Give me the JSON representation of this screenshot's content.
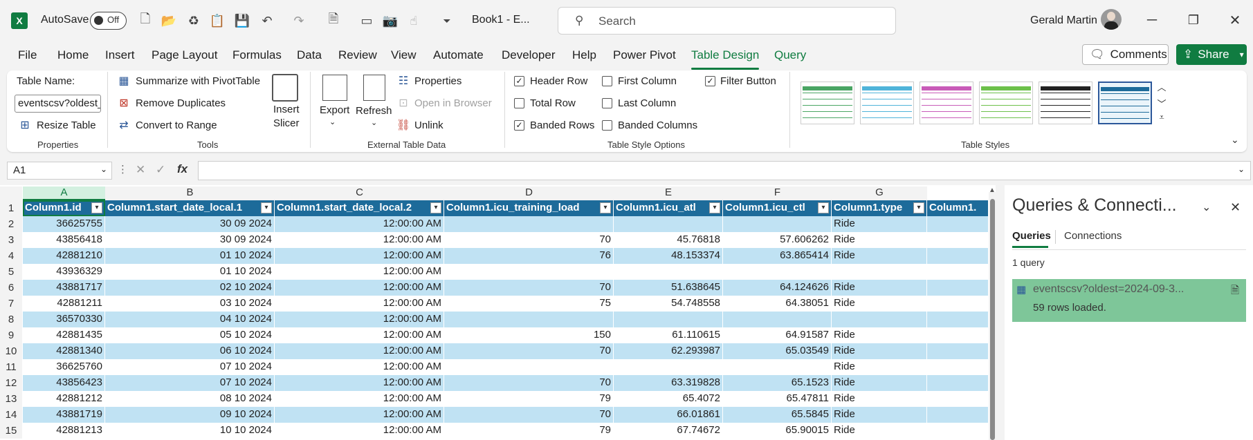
{
  "titlebar": {
    "autosave_label": "AutoSave",
    "autosave_state": "Off",
    "doc_title": "Book1  -  E...",
    "search_placeholder": "Search",
    "user_name": "Gerald Martin"
  },
  "menu": [
    "File",
    "Home",
    "Insert",
    "Page Layout",
    "Formulas",
    "Data",
    "Review",
    "View",
    "Automate",
    "Developer",
    "Help",
    "Power Pivot",
    "Table Design",
    "Query"
  ],
  "menu_active": "Table Design",
  "actions": {
    "comments": "Comments",
    "share": "Share"
  },
  "ribbon": {
    "properties": {
      "table_name_label": "Table Name:",
      "table_name_value": "eventscsv?oldest_",
      "resize": "Resize Table",
      "group": "Properties"
    },
    "tools": {
      "summarize": "Summarize with PivotTable",
      "remove_dup": "Remove Duplicates",
      "convert": "Convert to Range",
      "insert_slicer_1": "Insert",
      "insert_slicer_2": "Slicer",
      "group": "Tools"
    },
    "external": {
      "export": "Export",
      "refresh": "Refresh",
      "properties": "Properties",
      "open_browser": "Open in Browser",
      "unlink": "Unlink",
      "group": "External Table Data"
    },
    "style_options": {
      "header_row": "Header Row",
      "total_row": "Total Row",
      "banded_rows": "Banded Rows",
      "first_column": "First Column",
      "last_column": "Last Column",
      "banded_columns": "Banded Columns",
      "filter_button": "Filter Button",
      "group": "Table Style Options",
      "checked": {
        "header_row": true,
        "total_row": false,
        "banded_rows": true,
        "first_column": false,
        "last_column": false,
        "banded_columns": false,
        "filter_button": true
      }
    },
    "styles": {
      "group": "Table Styles",
      "colors": [
        "#4aa564",
        "#4fb3d9",
        "#c85bb8",
        "#6cc04a",
        "#222222",
        "#1d6b9a"
      ]
    }
  },
  "formula_bar": {
    "name_box": "A1",
    "fx": "fx",
    "formula": ""
  },
  "columns": [
    "A",
    "B",
    "C",
    "D",
    "E",
    "F",
    "G"
  ],
  "table": {
    "headers": [
      "Column1.id",
      "Column1.start_date_local.1",
      "Column1.start_date_local.2",
      "Column1.icu_training_load",
      "Column1.icu_atl",
      "Column1.icu_ctl",
      "Column1.type",
      "Column1."
    ],
    "rows": [
      [
        "36625755",
        "30 09 2024",
        "12:00:00 AM",
        "",
        "",
        "",
        "Ride",
        ""
      ],
      [
        "43856418",
        "30 09 2024",
        "12:00:00 AM",
        "70",
        "45.76818",
        "57.606262",
        "Ride",
        ""
      ],
      [
        "42881210",
        "01 10 2024",
        "12:00:00 AM",
        "76",
        "48.153374",
        "63.865414",
        "Ride",
        ""
      ],
      [
        "43936329",
        "01 10 2024",
        "12:00:00 AM",
        "",
        "",
        "",
        "",
        ""
      ],
      [
        "43881717",
        "02 10 2024",
        "12:00:00 AM",
        "70",
        "51.638645",
        "64.124626",
        "Ride",
        ""
      ],
      [
        "42881211",
        "03 10 2024",
        "12:00:00 AM",
        "75",
        "54.748558",
        "64.38051",
        "Ride",
        ""
      ],
      [
        "36570330",
        "04 10 2024",
        "12:00:00 AM",
        "",
        "",
        "",
        "",
        ""
      ],
      [
        "42881435",
        "05 10 2024",
        "12:00:00 AM",
        "150",
        "61.110615",
        "64.91587",
        "Ride",
        ""
      ],
      [
        "42881340",
        "06 10 2024",
        "12:00:00 AM",
        "70",
        "62.293987",
        "65.03549",
        "Ride",
        ""
      ],
      [
        "36625760",
        "07 10 2024",
        "12:00:00 AM",
        "",
        "",
        "",
        "Ride",
        ""
      ],
      [
        "43856423",
        "07 10 2024",
        "12:00:00 AM",
        "70",
        "63.319828",
        "65.1523",
        "Ride",
        ""
      ],
      [
        "42881212",
        "08 10 2024",
        "12:00:00 AM",
        "79",
        "65.4072",
        "65.47811",
        "Ride",
        ""
      ],
      [
        "43881719",
        "09 10 2024",
        "12:00:00 AM",
        "70",
        "66.01861",
        "65.5845",
        "Ride",
        ""
      ],
      [
        "42881213",
        "10 10 2024",
        "12:00:00 AM",
        "79",
        "67.74672",
        "65.90015",
        "Ride",
        ""
      ]
    ]
  },
  "pane": {
    "title": "Queries & Connecti...",
    "tab_queries": "Queries",
    "tab_connections": "Connections",
    "count": "1 query",
    "query_name": "eventscsv?oldest=2024-09-3...",
    "query_status": "59 rows loaded."
  }
}
